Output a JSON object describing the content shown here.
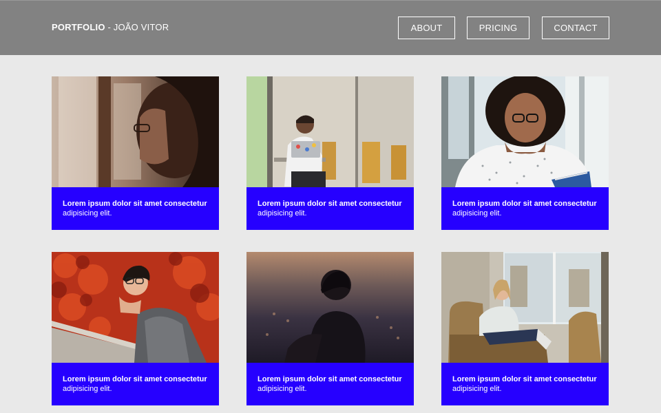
{
  "header": {
    "brand_strong": "PORTFOLIO",
    "brand_light": " - JOÃO VITOR",
    "nav": {
      "about": "ABOUT",
      "pricing": "PRICING",
      "contact": "CONTACT"
    }
  },
  "colors": {
    "header_bg": "#828282",
    "page_bg": "#e9e9e9",
    "card_accent": "#2600ff",
    "text_on_dark": "#ffffff"
  },
  "cards": [
    {
      "title": "Lorem ipsum dolor sit amet consectetur",
      "subtitle": "adipisicing elit.",
      "photo": "woman-profile-window-photo"
    },
    {
      "title": "Lorem ipsum dolor sit amet consectetur",
      "subtitle": "adipisicing elit.",
      "photo": "man-laptop-office-photo"
    },
    {
      "title": "Lorem ipsum dolor sit amet consectetur",
      "subtitle": "adipisicing elit.",
      "photo": "woman-glasses-reading-photo"
    },
    {
      "title": "Lorem ipsum dolor sit amet consectetur",
      "subtitle": "adipisicing elit.",
      "photo": "woman-autumn-leaves-photo"
    },
    {
      "title": "Lorem ipsum dolor sit amet consectetur",
      "subtitle": "adipisicing elit.",
      "photo": "woman-sunset-silhouette-photo"
    },
    {
      "title": "Lorem ipsum dolor sit amet consectetur",
      "subtitle": "adipisicing elit.",
      "photo": "woman-armchair-room-photo"
    }
  ]
}
